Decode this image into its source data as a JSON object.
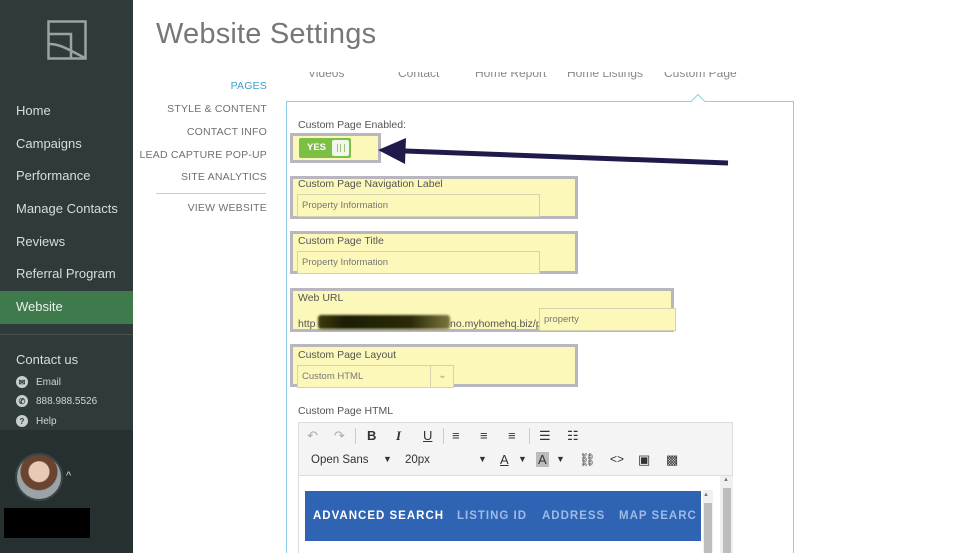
{
  "page": {
    "title": "Website Settings"
  },
  "sidebar": {
    "items": [
      {
        "label": "Home",
        "active": false
      },
      {
        "label": "Campaigns",
        "active": false
      },
      {
        "label": "Performance",
        "active": false
      },
      {
        "label": "Manage Contacts",
        "active": false
      },
      {
        "label": "Reviews",
        "active": false
      },
      {
        "label": "Referral Program",
        "active": false
      },
      {
        "label": "Website",
        "active": true
      }
    ],
    "contact": {
      "title": "Contact us",
      "email": "Email",
      "phone": "888.988.5526",
      "help": "Help"
    }
  },
  "subnav": {
    "items": [
      {
        "label": "PAGES",
        "active": true
      },
      {
        "label": "STYLE & CONTENT",
        "active": false
      },
      {
        "label": "CONTACT INFO",
        "active": false
      },
      {
        "label": "LEAD CAPTURE POP-UP",
        "active": false
      },
      {
        "label": "SITE ANALYTICS",
        "active": false
      }
    ],
    "view_website": "VIEW WEBSITE"
  },
  "tabs": [
    "Videos",
    "Contact",
    "Home Report",
    "Home Listings",
    "Custom Page"
  ],
  "form": {
    "enabled_label": "Custom Page Enabled:",
    "toggle_text": "YES",
    "nav_label": "Custom Page Navigation Label",
    "nav_value": "Property Information",
    "title_label": "Custom Page Title",
    "title_value": "Property Information",
    "url_label": "Web URL",
    "url_prefix": "http",
    "url_suffix": "no.myhomehq.biz/p/",
    "url_slug": "property",
    "layout_label": "Custom Page Layout",
    "layout_value": "Custom HTML",
    "html_label": "Custom Page HTML"
  },
  "editor": {
    "font": "Open Sans",
    "size": "20px",
    "preview": {
      "active": "ADVANCED SEARCH",
      "others": [
        "LISTING ID",
        "ADDRESS",
        "MAP SEARC"
      ]
    }
  },
  "colors": {
    "sidebar_bg": "#2f3a3b",
    "active_nav": "#3e7a4c",
    "accent": "#3aa0c8",
    "highlight": "#fcf8b9",
    "toggle_on": "#7bbf45",
    "preview_bar": "#2e64b3",
    "arrow": "#1e1b4a"
  },
  "icons": [
    "logo-icon",
    "email-icon",
    "phone-icon",
    "help-icon",
    "undo-icon",
    "redo-icon",
    "bold-icon",
    "italic-icon",
    "underline-icon",
    "align-left-icon",
    "align-center-icon",
    "align-right-icon",
    "bullet-list-icon",
    "numbered-list-icon",
    "text-color-icon",
    "background-color-icon",
    "link-icon",
    "code-icon",
    "image-icon",
    "media-icon"
  ]
}
